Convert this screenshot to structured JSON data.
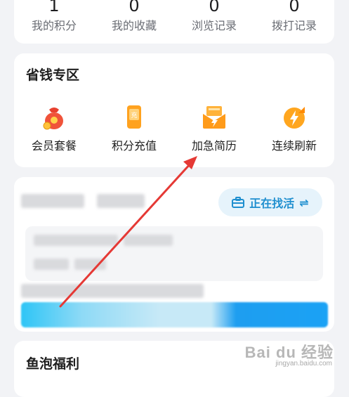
{
  "stats": [
    {
      "value": "1",
      "label": "我的积分"
    },
    {
      "value": "0",
      "label": "我的收藏"
    },
    {
      "value": "0",
      "label": "浏览记录"
    },
    {
      "value": "0",
      "label": "拨打记录"
    }
  ],
  "saving_zone": {
    "title": "省钱专区",
    "items": [
      {
        "label": "会员套餐",
        "icon": "money-bag-icon"
      },
      {
        "label": "积分充值",
        "icon": "recharge-phone-icon"
      },
      {
        "label": "加急简历",
        "icon": "urgent-resume-icon"
      },
      {
        "label": "连续刷新",
        "icon": "refresh-bolt-icon"
      }
    ]
  },
  "job_card": {
    "status_button": "正在找活"
  },
  "bottom_section": {
    "title": "鱼泡福利"
  },
  "watermark": {
    "text": "Bai du 经验",
    "sub": "jingyan.baidu.com"
  },
  "colors": {
    "accent": "#1f8fcf",
    "annotation_arrow": "#e53935"
  }
}
